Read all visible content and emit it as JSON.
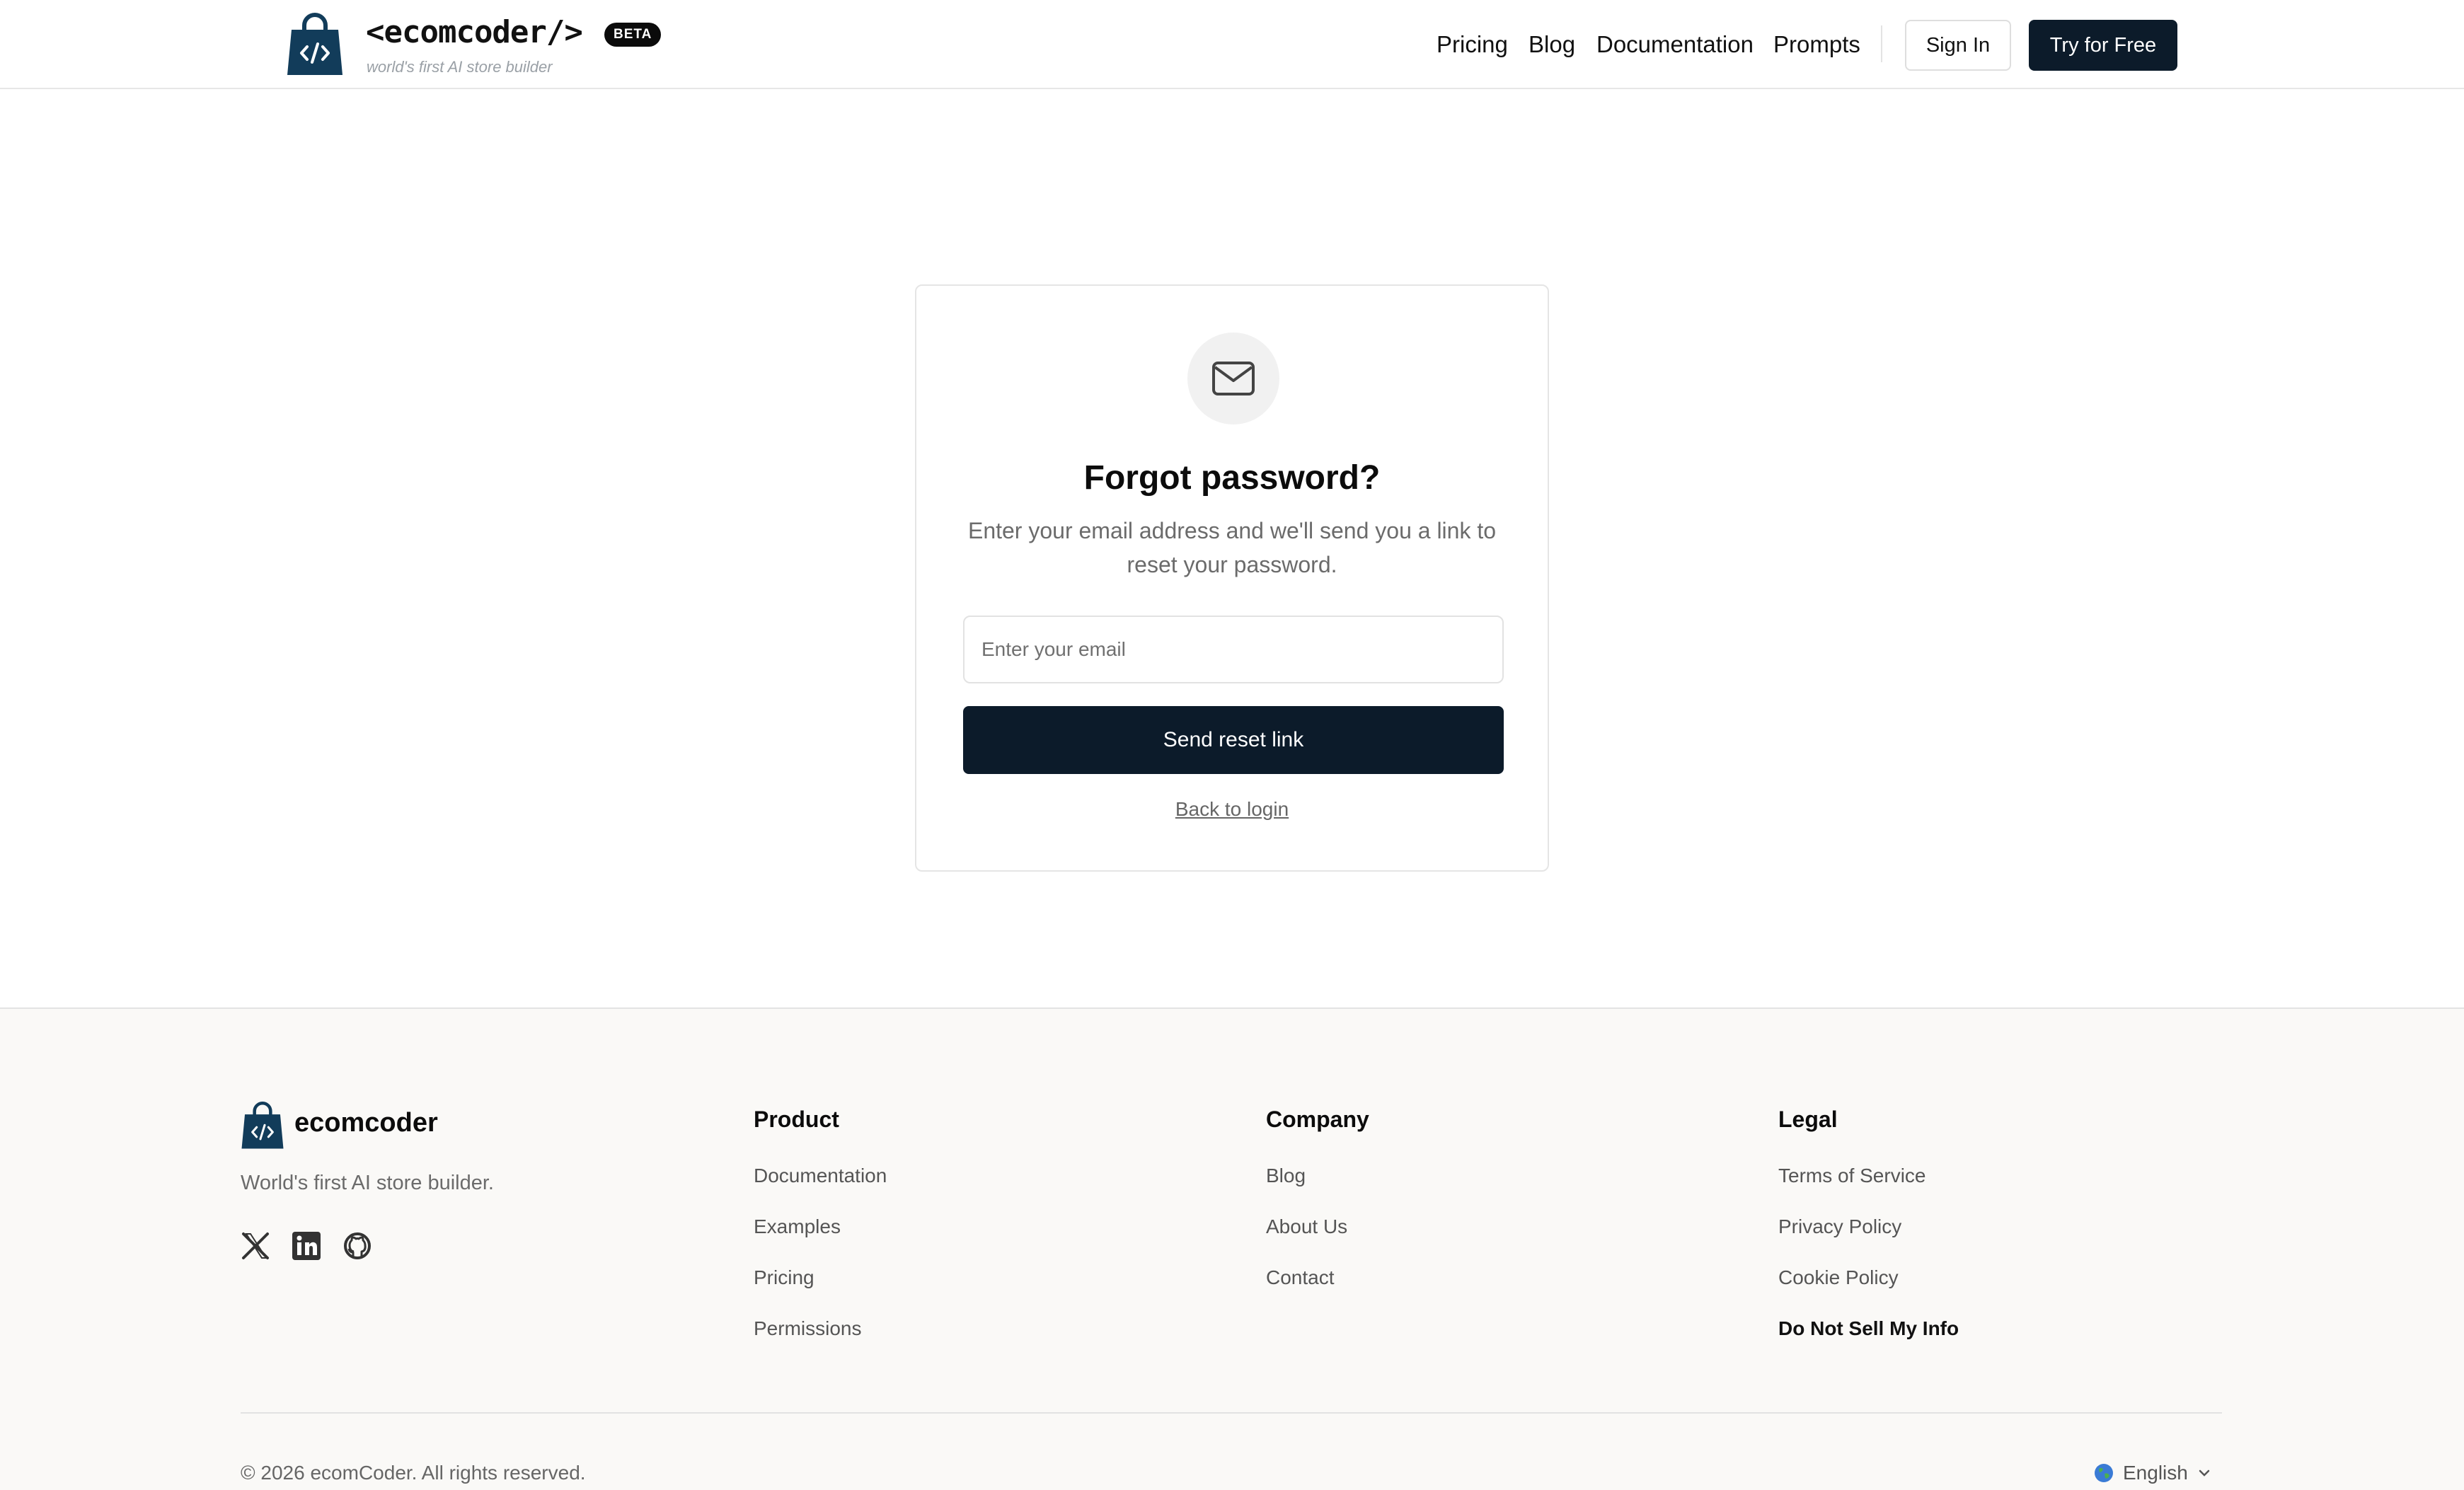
{
  "header": {
    "brand": "<ecomcoder/>",
    "beta": "BETA",
    "tagline": "world's first AI store builder",
    "nav": [
      "Pricing",
      "Blog",
      "Documentation",
      "Prompts"
    ],
    "sign_in": "Sign In",
    "try_free": "Try for Free"
  },
  "card": {
    "title": "Forgot password?",
    "subtitle": "Enter your email address and we'll send you a link to reset your password.",
    "email_placeholder": "Enter your email",
    "email_value": "",
    "send_button": "Send reset link",
    "back_link": "Back to login"
  },
  "footer": {
    "brand": "ecomcoder",
    "tagline": "World's first AI store builder.",
    "columns": [
      {
        "heading": "Product",
        "links": [
          "Documentation",
          "Examples",
          "Pricing",
          "Permissions"
        ]
      },
      {
        "heading": "Company",
        "links": [
          "Blog",
          "About Us",
          "Contact"
        ]
      },
      {
        "heading": "Legal",
        "links": [
          "Terms of Service",
          "Privacy Policy",
          "Cookie Policy",
          "Do Not Sell My Info"
        ]
      }
    ],
    "copyright": "© 2026 ecomCoder. All rights reserved.",
    "language": "English",
    "social_icons": [
      "x-icon",
      "linkedin-icon",
      "github-icon"
    ]
  },
  "colors": {
    "primary": "#0c1b2a",
    "footer_bg": "#faf9f7",
    "logo": "#123c5a"
  }
}
